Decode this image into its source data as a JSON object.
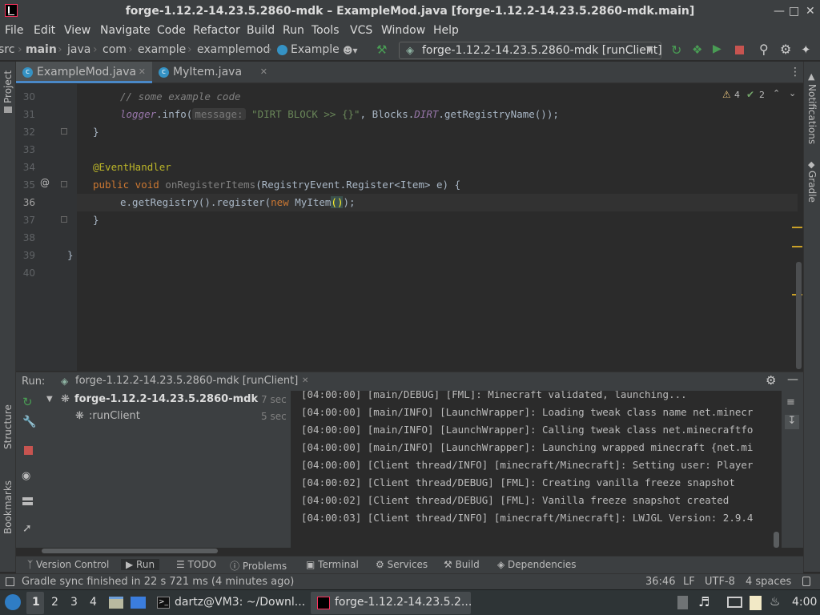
{
  "window": {
    "title": "forge-1.12.2-14.23.5.2860-mdk – ExampleMod.java [forge-1.12.2-14.23.5.2860-mdk.main]"
  },
  "menu": [
    "File",
    "Edit",
    "View",
    "Navigate",
    "Code",
    "Refactor",
    "Build",
    "Run",
    "Tools",
    "VCS",
    "Window",
    "Help"
  ],
  "breadcrumb": [
    "src",
    "main",
    "java",
    "com",
    "example",
    "examplemod",
    "Example"
  ],
  "run_config": "forge-1.12.2-14.23.5.2860-mdk [runClient]",
  "left_strip": {
    "project": "Project",
    "structure": "Structure",
    "bookmarks": "Bookmarks"
  },
  "right_strip": {
    "notifications": "Notifications",
    "gradle": "Gradle"
  },
  "tabs": [
    {
      "label": "ExampleMod.java",
      "active": true
    },
    {
      "label": "MyItem.java",
      "active": false
    }
  ],
  "inspections": {
    "warnings": "4",
    "weak_warnings": "2"
  },
  "editor": {
    "line_numbers": [
      "30",
      "31",
      "32",
      "33",
      "34",
      "35",
      "36",
      "37",
      "38",
      "39",
      "40"
    ],
    "current_line": "36",
    "l30": "// some example code",
    "l31_a": "logger",
    "l31_b": ".info(",
    "l31_hint": "message:",
    "l31_str": "\"DIRT BLOCK >> {}\"",
    "l31_c": ", Blocks.",
    "l31_fld": "DIRT",
    "l31_d": ".getRegistryName());",
    "l32": "}",
    "l34": "@EventHandler",
    "l35_kw": "public void",
    "l35_fn": "onRegisterItems",
    "l35_rest": "(RegistryEvent.Register<Item> e) {",
    "l36_a": "e.getRegistry().register(",
    "l36_kw": "new",
    "l36_b": "MyItem",
    "l36_paren": "()",
    "l36_c": ");",
    "l37": "}",
    "l39": "}"
  },
  "run_panel": {
    "label": "Run:",
    "tab": "forge-1.12.2-14.23.5.2860-mdk [runClient]",
    "tree": [
      {
        "label": "forge-1.12.2-14.23.5.2860-mdk",
        "time": "7 sec"
      },
      {
        "label": ":runClient",
        "time": "5 sec"
      }
    ],
    "console": [
      "[04:00:00] [main/DEBUG] [FML]: Minecraft validated, launching...",
      "[04:00:00] [main/INFO] [LaunchWrapper]: Loading tweak class name net.minecr",
      "[04:00:00] [main/INFO] [LaunchWrapper]: Calling tweak class net.minecraftfo",
      "[04:00:00] [main/INFO] [LaunchWrapper]: Launching wrapped minecraft {net.mi",
      "[04:00:00] [Client thread/INFO] [minecraft/Minecraft]: Setting user: Player",
      "[04:00:02] [Client thread/DEBUG] [FML]: Creating vanilla freeze snapshot",
      "[04:00:02] [Client thread/DEBUG] [FML]: Vanilla freeze snapshot created",
      "[04:00:03] [Client thread/INFO] [minecraft/Minecraft]: LWJGL Version: 2.9.4"
    ]
  },
  "bottom_tabs": [
    "Version Control",
    "Run",
    "TODO",
    "Problems",
    "Terminal",
    "Services",
    "Build",
    "Dependencies"
  ],
  "status": {
    "message": "Gradle sync finished in 22 s 721 ms (4 minutes ago)",
    "position": "36:46",
    "line_sep": "LF",
    "encoding": "UTF-8",
    "indent": "4 spaces"
  },
  "taskbar": {
    "workspaces": [
      "1",
      "2",
      "3",
      "4"
    ],
    "terminal": "dartz@VM3: ~/Downl...",
    "ide": "forge-1.12.2-14.23.5.2...",
    "clock": "4:00"
  },
  "colors": {
    "accent": "#4a88c7",
    "background": "#2b2b2b",
    "panel": "#3c3f41",
    "warning": "#e5c07b",
    "run_green": "#499c54",
    "stop_red": "#c75450"
  }
}
